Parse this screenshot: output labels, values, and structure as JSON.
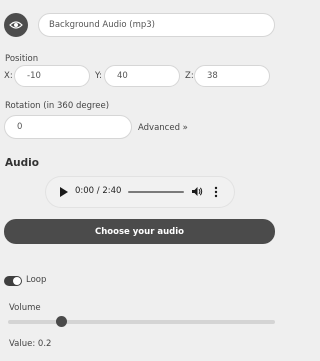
{
  "layer": {
    "visibility_icon": "eye-icon",
    "name_value": "Background Audio (mp3)"
  },
  "position": {
    "label": "Position",
    "x_label": "X:",
    "x_value": "-10",
    "y_label": "Y:",
    "y_value": "40",
    "z_label": "Z:",
    "z_value": "38"
  },
  "rotation": {
    "label": "Rotation (in 360 degree)",
    "value": "0",
    "advanced_link": "Advanced »"
  },
  "audio": {
    "title": "Audio",
    "player": {
      "play_icon": "play-icon",
      "time": "0:00 / 2:40",
      "progress": 0,
      "volume_icon": "volume-icon",
      "menu_icon": "more-vertical-icon"
    },
    "choose_button": "Choose your audio",
    "loop": {
      "label": "Loop",
      "enabled": true
    },
    "volume": {
      "label": "Volume",
      "value_text": "Value: 0.2",
      "level": 0.2
    }
  },
  "colors": {
    "background": "#efefef",
    "accent_dark": "#4b4b4b",
    "input_bg": "#ffffff"
  }
}
